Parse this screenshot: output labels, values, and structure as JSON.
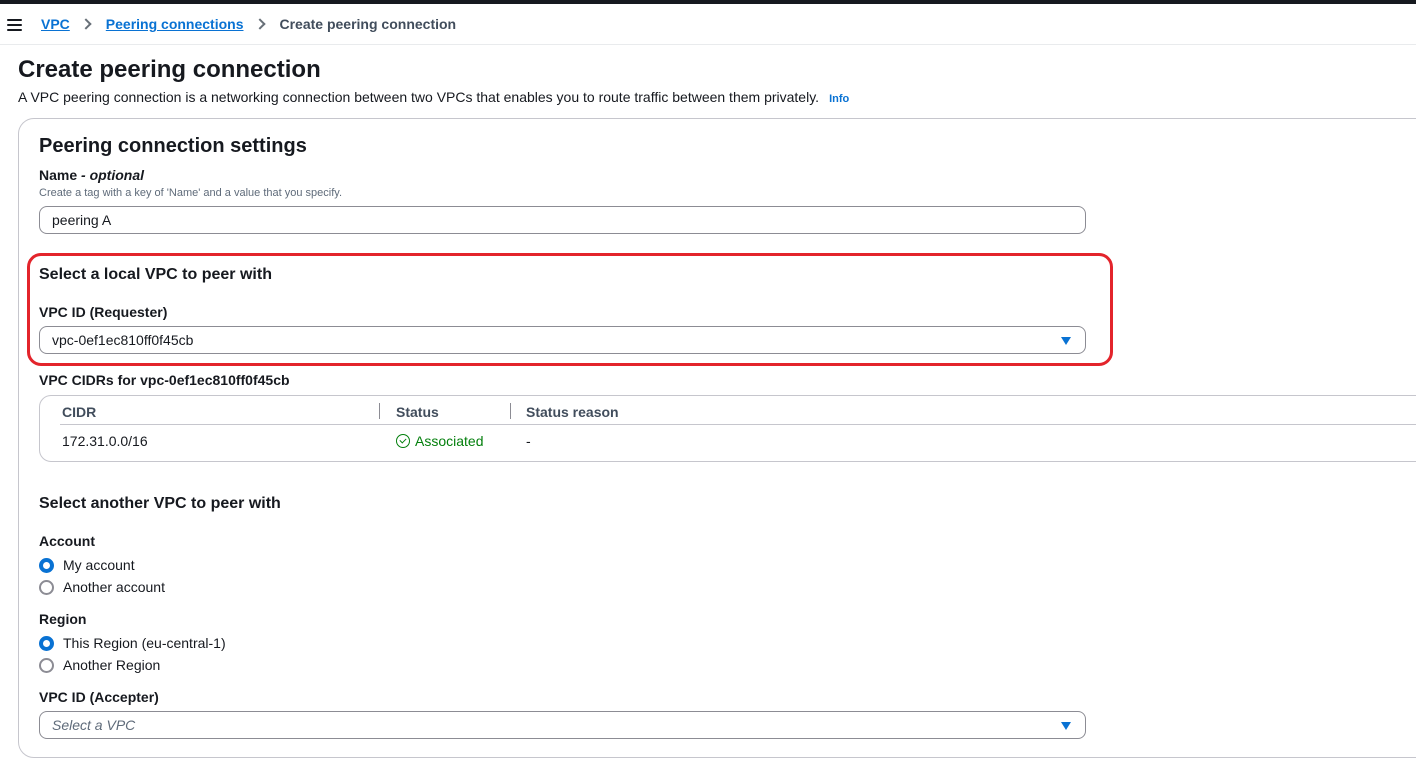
{
  "breadcrumb": {
    "items": [
      "VPC",
      "Peering connections"
    ],
    "current": "Create peering connection"
  },
  "page": {
    "title": "Create peering connection",
    "description": "A VPC peering connection is a networking connection between two VPCs that enables you to route traffic between them privately.",
    "info_label": "Info"
  },
  "settings": {
    "title": "Peering connection settings",
    "name_label": "Name",
    "name_optional": "- optional",
    "name_hint": "Create a tag with a key of 'Name' and a value that you specify.",
    "name_value": "peering A"
  },
  "local_vpc": {
    "heading": "Select a local VPC to peer with",
    "vpc_id_label": "VPC ID (Requester)",
    "vpc_id_value": "vpc-0ef1ec810ff0f45cb",
    "cidrs_label": "VPC CIDRs for vpc-0ef1ec810ff0f45cb",
    "table": {
      "columns": [
        "CIDR",
        "Status",
        "Status reason"
      ],
      "rows": [
        {
          "cidr": "172.31.0.0/16",
          "status": "Associated",
          "reason": "-"
        }
      ]
    }
  },
  "another_vpc": {
    "heading": "Select another VPC to peer with",
    "account_label": "Account",
    "account_options": [
      "My account",
      "Another account"
    ],
    "account_selected": "My account",
    "region_label": "Region",
    "region_options": [
      "This Region (eu-central-1)",
      "Another Region"
    ],
    "region_selected": "This Region (eu-central-1)",
    "accepter_label": "VPC ID (Accepter)",
    "accepter_placeholder": "Select a VPC"
  },
  "colors": {
    "link": "#0972d3",
    "success": "#037f0c",
    "highlight": "#e3242b"
  },
  "icons": [
    "menu-icon",
    "chevron-right-icon",
    "caret-down-icon",
    "status-check-icon"
  ]
}
